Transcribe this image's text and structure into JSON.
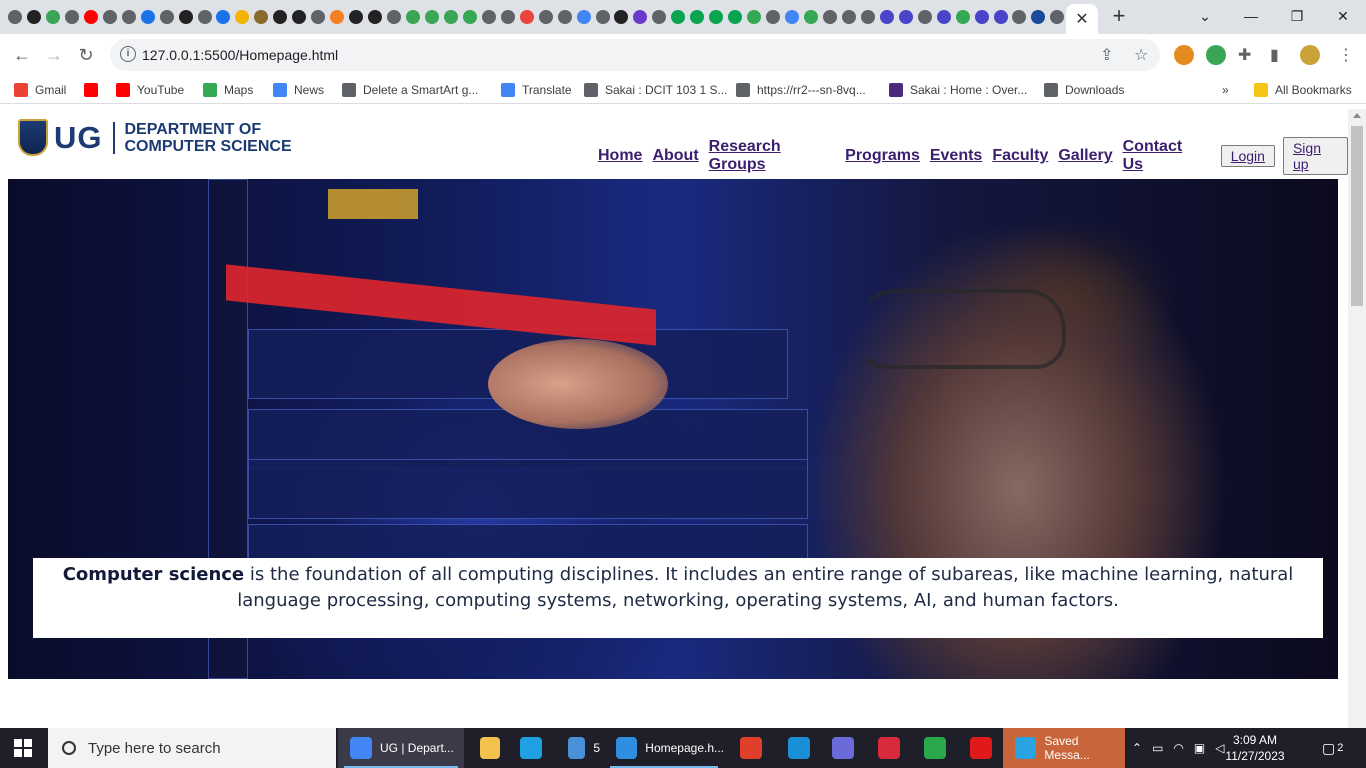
{
  "browser": {
    "tab_close_label": "✕",
    "new_tab_label": "+",
    "url": "127.0.0.1:5500/Homepage.html",
    "bookmarks": [
      {
        "label": "Gmail",
        "icon": "gmail-icon",
        "color": "#ea4335"
      },
      {
        "label": "",
        "icon": "youtube-icon",
        "color": "#ff0000"
      },
      {
        "label": "YouTube",
        "icon": "youtube-icon",
        "color": "#ff0000"
      },
      {
        "label": "Maps",
        "icon": "maps-icon",
        "color": "#34a853"
      },
      {
        "label": "News",
        "icon": "news-icon",
        "color": "#4285f4"
      },
      {
        "label": "Delete a SmartArt g...",
        "icon": "globe-icon",
        "color": "#5f6368"
      },
      {
        "label": "Translate",
        "icon": "translate-icon",
        "color": "#4285f4"
      },
      {
        "label": "Sakai : DCIT 103 1 S...",
        "icon": "globe-icon",
        "color": "#5f6368"
      },
      {
        "label": "https://rr2---sn-8vq...",
        "icon": "globe-icon",
        "color": "#5f6368"
      },
      {
        "label": "Sakai : Home : Over...",
        "icon": "sakai-icon",
        "color": "#4a2a7a"
      },
      {
        "label": "Downloads",
        "icon": "download-icon",
        "color": "#5f6368"
      }
    ],
    "bookmarks_overflow": "»",
    "all_bookmarks": "All Bookmarks"
  },
  "site": {
    "logo_ug": "UG",
    "logo_line1": "DEPARTMENT OF",
    "logo_line2": "COMPUTER SCIENCE",
    "nav": [
      "Home",
      "About",
      "Research Groups",
      "Programs",
      "Events",
      "Faculty",
      "Gallery",
      "Contact Us"
    ],
    "login": "Login",
    "signup": "Sign up",
    "caption_bold": "Computer science",
    "caption_rest": " is the foundation of all computing disciplines. It includes an entire range of subareas, like machine learning, natural language processing, computing systems, networking, operating systems, AI, and human factors."
  },
  "taskbar": {
    "search_placeholder": "Type here to search",
    "apps": [
      {
        "label": "UG | Depart...",
        "icon": "chrome-icon",
        "color": "#4285f4"
      },
      {
        "label": "",
        "icon": "file-explorer-icon",
        "color": "#f2c14e"
      },
      {
        "label": "",
        "icon": "edge-icon",
        "color": "#1fa0e0"
      },
      {
        "label": "5",
        "icon": "mail-icon",
        "color": "#4a90d9"
      },
      {
        "label": "Homepage.h...",
        "icon": "vscode-icon",
        "color": "#2f8ee0"
      },
      {
        "label": "",
        "icon": "app-icon",
        "color": "#e0402a"
      },
      {
        "label": "",
        "icon": "shield-app-icon",
        "color": "#1a8fd8"
      },
      {
        "label": "",
        "icon": "app-icon",
        "color": "#6a6ad8"
      },
      {
        "label": "",
        "icon": "recorder-icon",
        "color": "#d82a3a"
      },
      {
        "label": "",
        "icon": "app-icon",
        "color": "#2aa84a"
      },
      {
        "label": "",
        "icon": "opera-icon",
        "color": "#e01a1a"
      },
      {
        "label": "Saved Messa...",
        "icon": "telegram-icon",
        "color": "#2aa3e0"
      }
    ],
    "time": "3:09 AM",
    "date": "11/27/2023",
    "notification_count": "2"
  }
}
